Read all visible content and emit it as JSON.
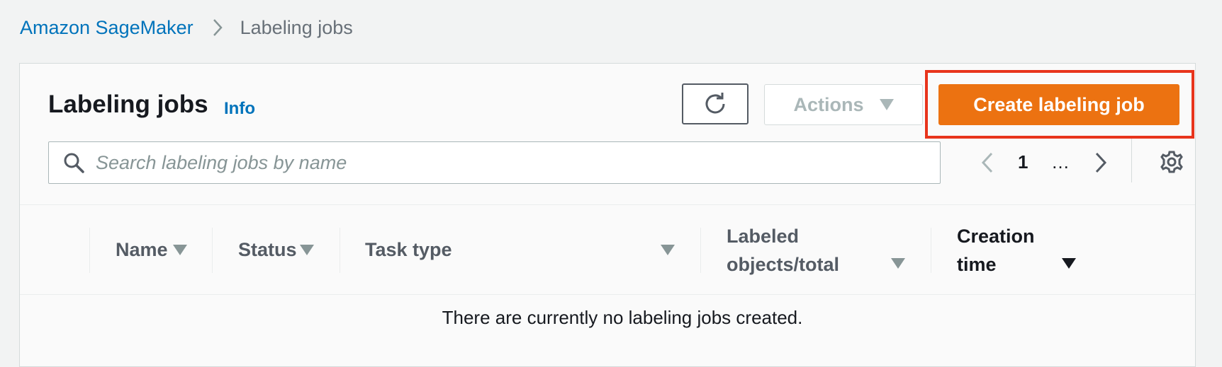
{
  "breadcrumb": {
    "root": "Amazon SageMaker",
    "current": "Labeling jobs"
  },
  "panel": {
    "title": "Labeling jobs",
    "info": "Info"
  },
  "toolbar": {
    "refresh_icon": "refresh-icon",
    "actions_label": "Actions",
    "create_label": "Create labeling job"
  },
  "search": {
    "placeholder": "Search labeling jobs by name",
    "value": ""
  },
  "pagination": {
    "current_page": "1",
    "ellipsis": "…"
  },
  "table": {
    "columns": [
      {
        "label": "Name"
      },
      {
        "label": "Status"
      },
      {
        "label": "Task type"
      },
      {
        "label": "Labeled",
        "label2": "objects/total"
      },
      {
        "label": "Creation",
        "label2": "time"
      }
    ],
    "empty_message": "There are currently no labeling jobs created."
  },
  "colors": {
    "accent_link": "#0073bb",
    "primary_button": "#ec7211",
    "highlight_box": "#e8341c",
    "background": "#f2f3f3"
  }
}
